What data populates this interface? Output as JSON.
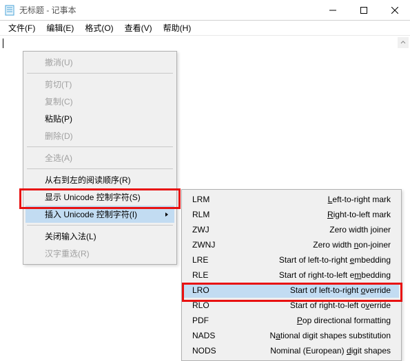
{
  "window": {
    "title": "无标题 - 记事本"
  },
  "menubar": {
    "file": "文件(F)",
    "edit": "编辑(E)",
    "format": "格式(O)",
    "view": "查看(V)",
    "help": "帮助(H)"
  },
  "context_menu": {
    "undo": "撤消(U)",
    "cut": "剪切(T)",
    "copy": "复制(C)",
    "paste": "粘贴(P)",
    "delete": "删除(D)",
    "select_all": "全选(A)",
    "rtl_reading": "从右到左的阅读顺序(R)",
    "show_unicode": "显示 Unicode 控制字符(S)",
    "insert_unicode": "插入 Unicode 控制字符(I)",
    "close_ime": "关闭输入法(L)",
    "reconvert": "汉字重选(R)"
  },
  "submenu": [
    {
      "abbr": "LRM",
      "desc_pre": "",
      "u": "L",
      "desc_post": "eft-to-right mark"
    },
    {
      "abbr": "RLM",
      "desc_pre": "",
      "u": "R",
      "desc_post": "ight-to-left mark"
    },
    {
      "abbr": "ZWJ",
      "desc_pre": "Zero width ",
      "u": "j",
      "desc_post": "oiner"
    },
    {
      "abbr": "ZWNJ",
      "desc_pre": "Zero width ",
      "u": "n",
      "desc_post": "on-joiner"
    },
    {
      "abbr": "LRE",
      "desc_pre": "Start of left-to-right ",
      "u": "e",
      "desc_post": "mbedding"
    },
    {
      "abbr": "RLE",
      "desc_pre": "Start of right-to-left e",
      "u": "m",
      "desc_post": "bedding"
    },
    {
      "abbr": "LRO",
      "desc_pre": "Start of left-to-right ",
      "u": "o",
      "desc_post": "verride"
    },
    {
      "abbr": "RLO",
      "desc_pre": "Start of right-to-left o",
      "u": "v",
      "desc_post": "erride"
    },
    {
      "abbr": "PDF",
      "desc_pre": "",
      "u": "P",
      "desc_post": "op directional formatting"
    },
    {
      "abbr": "NADS",
      "desc_pre": "N",
      "u": "a",
      "desc_post": "tional digit shapes substitution"
    },
    {
      "abbr": "NODS",
      "desc_pre": "Nominal (European) ",
      "u": "d",
      "desc_post": "igit shapes"
    }
  ]
}
